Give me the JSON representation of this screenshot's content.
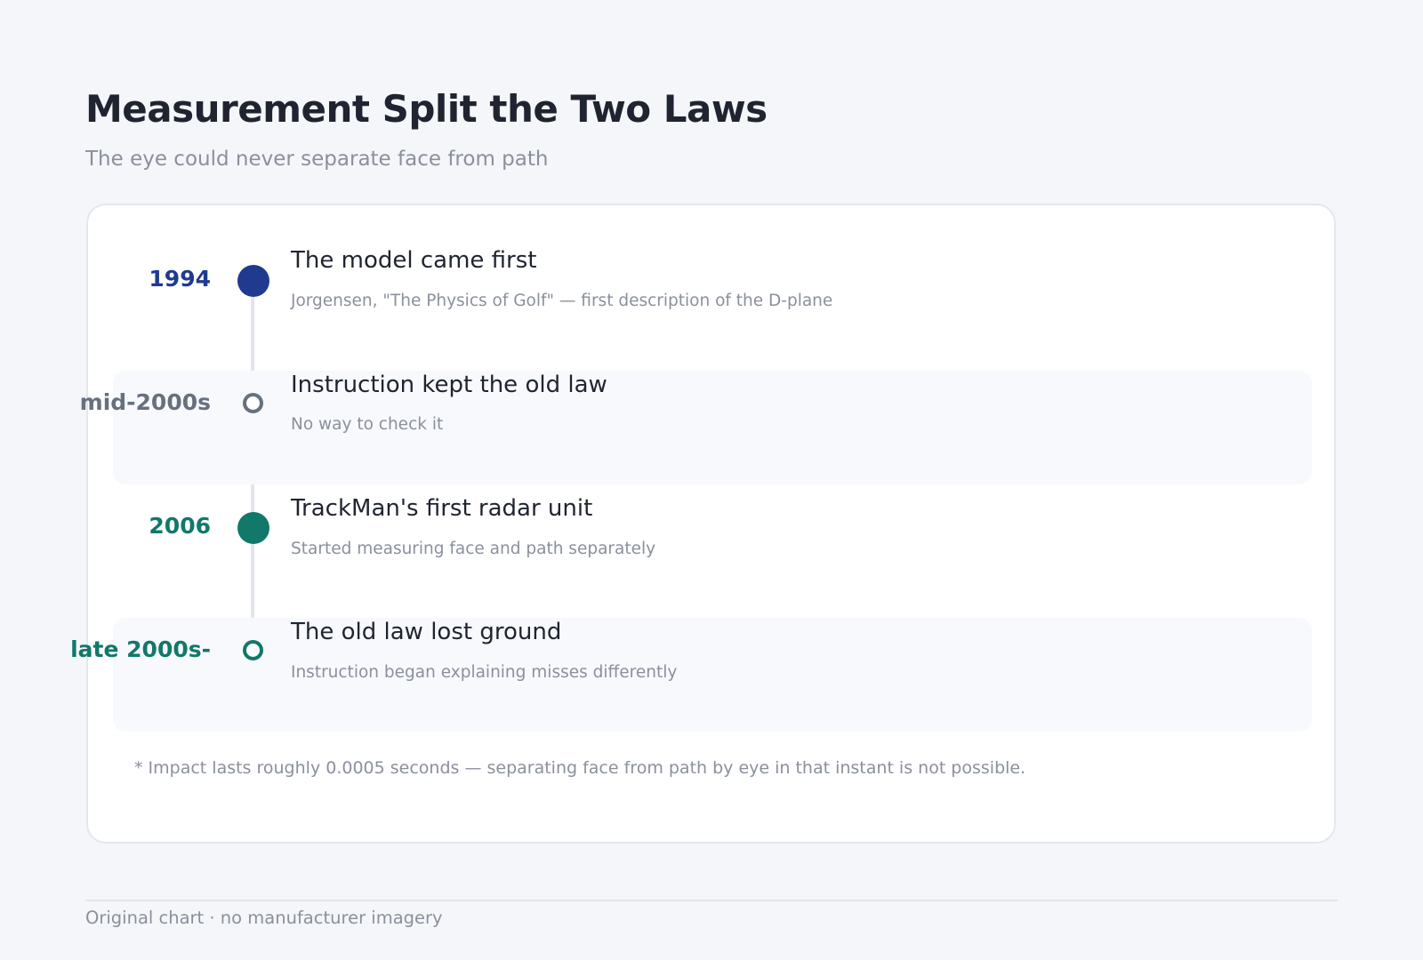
{
  "header": {
    "title": "Measurement Split the Two Laws",
    "subtitle": "The eye could never separate face from path"
  },
  "colors": {
    "navy": "#1f3a8f",
    "slate": "#66707f",
    "teal": "#11786a",
    "line": "#e3e5ea",
    "shade": "#f8f9fd"
  },
  "timeline": [
    {
      "date": "1994",
      "title": "The model came first",
      "description": "Jorgensen, \"The Physics of Golf\" — first description of the D-plane",
      "marker": "filled",
      "color": "#1f3a8f"
    },
    {
      "date": "mid-2000s",
      "title": "Instruction kept the old law",
      "description": "No way to check it",
      "marker": "hollow",
      "color": "#66707f"
    },
    {
      "date": "2006",
      "title": "TrackMan's first radar unit",
      "description": "Started measuring face and path separately",
      "marker": "filled",
      "color": "#11786a"
    },
    {
      "date": "late 2000s-",
      "title": "The old law lost ground",
      "description": "Instruction began explaining misses differently",
      "marker": "hollow",
      "color": "#11786a"
    }
  ],
  "footnote": "* Impact lasts roughly 0.0005 seconds — separating face from path by eye in that instant is not possible.",
  "footer": "Original chart · no manufacturer imagery"
}
